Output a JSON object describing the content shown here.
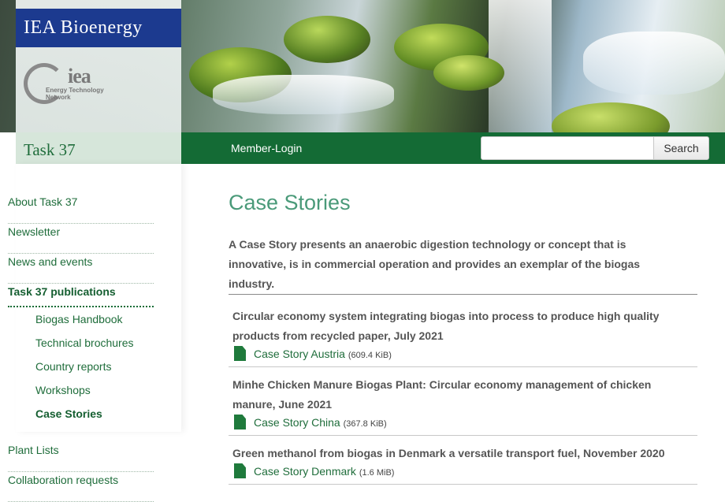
{
  "header": {
    "site_title": "IEA Bioenergy",
    "logo_text": "iea",
    "logo_subtitle": "Energy Technology Network",
    "task_label": "Task 37"
  },
  "navbar": {
    "member_login": "Member-Login",
    "search_placeholder": "",
    "search_button": "Search"
  },
  "sidebar": {
    "items": [
      {
        "label": "About Task 37"
      },
      {
        "label": "Newsletter"
      },
      {
        "label": "News and events"
      },
      {
        "label": "Task 37 publications"
      },
      {
        "label": "Plant Lists"
      },
      {
        "label": "Collaboration requests"
      }
    ],
    "sub_items": [
      {
        "label": "Biogas Handbook"
      },
      {
        "label": "Technical brochures"
      },
      {
        "label": "Country reports"
      },
      {
        "label": "Workshops"
      },
      {
        "label": "Case Stories"
      }
    ]
  },
  "main": {
    "title": "Case Stories",
    "intro": "A Case Story presents an anaerobic digestion technology or concept that is innovative, is in commercial operation and provides an exemplar of the biogas industry.",
    "stories": [
      {
        "title": "Circular economy system integrating biogas into process to produce high quality products from recycled paper, July 2021",
        "file_label": "Case Story Austria",
        "file_size": "(609.4 KiB)"
      },
      {
        "title": "Minhe Chicken Manure Biogas Plant: Circular economy management of chicken manure, June 2021",
        "file_label": "Case Story China",
        "file_size": "(367.8 KiB)"
      },
      {
        "title": "Green methanol from biogas in Denmark a versatile transport fuel, November 2020",
        "file_label": "Case Story Denmark",
        "file_size": "(1.6 MiB)"
      }
    ]
  },
  "colors": {
    "brand_blue": "#1c3a8f",
    "nav_green": "#146b35",
    "title_green": "#4a9a79",
    "link_green": "#1f6d3b"
  },
  "icons": {
    "file": "pdf-file-icon"
  }
}
